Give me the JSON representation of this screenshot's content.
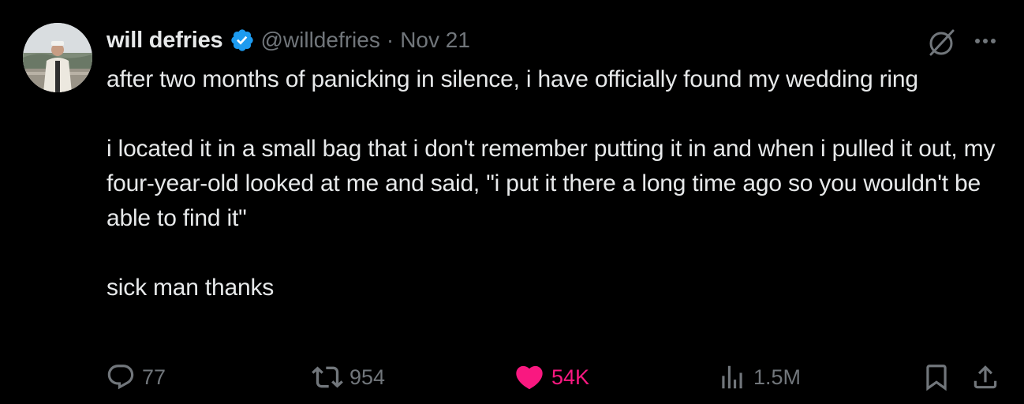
{
  "author": {
    "display_name": "will defries",
    "handle": "@willdefries",
    "separator": "·",
    "date": "Nov 21",
    "verified": true,
    "avatar_icon": "profile-photo"
  },
  "tweet": {
    "text": "after two months of panicking in silence, i have officially found my wedding ring\n\ni located it in a small bag that i don't remember putting it in and when i pulled it out, my four-year-old looked at me and said, \"i put it there a long time ago so you wouldn't be able to find it\"\n\nsick man thanks"
  },
  "actions": {
    "reply": {
      "icon": "reply-icon",
      "count": "77"
    },
    "retweet": {
      "icon": "retweet-icon",
      "count": "954"
    },
    "like": {
      "icon": "heart-icon",
      "count": "54K",
      "liked": true
    },
    "views": {
      "icon": "views-icon",
      "count": "1.5M"
    },
    "bookmark": {
      "icon": "bookmark-icon"
    },
    "share": {
      "icon": "share-icon"
    }
  },
  "top_right": {
    "grok_icon": "grok-icon",
    "more_icon": "more-icon"
  },
  "colors": {
    "background": "#000000",
    "text": "#e7e9ea",
    "muted": "#71767b",
    "verified_blue": "#1d9bf0",
    "like_pink": "#f91880"
  }
}
